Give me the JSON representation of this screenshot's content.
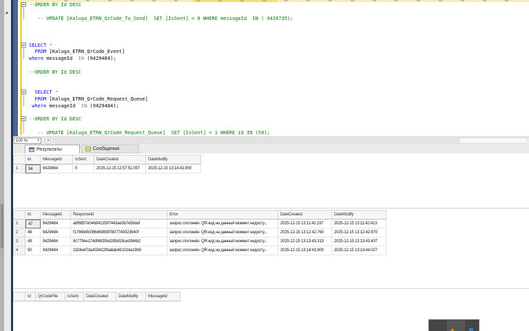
{
  "editor": {
    "zoom_level": "100 %",
    "code_lines": [
      {
        "fold": true,
        "segments": [
          {
            "s": "com",
            "t": "--ORDER BY Id DESC"
          }
        ]
      },
      {
        "segments": []
      },
      {
        "segments": [
          {
            "s": "com",
            "t": "   -- UPDATE [Kaluga_ETRN_QrCode_To_Send]  SET [IsSent] = 0 WHERE messageId  IN ( 9426735);"
          }
        ]
      },
      {
        "segments": []
      },
      {
        "segments": []
      },
      {
        "segments": []
      },
      {
        "fold": true,
        "segments": [
          {
            "s": "kw",
            "t": "SELECT"
          },
          {
            "s": "op",
            "t": " *"
          }
        ]
      },
      {
        "segments": [
          {
            "s": "def",
            "t": "  "
          },
          {
            "s": "kw",
            "t": "FROM"
          },
          {
            "s": "def",
            "t": " [Kaluga_ETRN_QrCode_Event]"
          }
        ]
      },
      {
        "segments": [
          {
            "s": "kw",
            "t": "where"
          },
          {
            "s": "def",
            "t": " messageId  "
          },
          {
            "s": "op",
            "t": "IN"
          },
          {
            "s": "def",
            "t": " (9429484);"
          }
        ]
      },
      {
        "segments": []
      },
      {
        "segments": [
          {
            "s": "com",
            "t": "--ORDER BY Id DESC"
          }
        ]
      },
      {
        "segments": []
      },
      {
        "segments": []
      },
      {
        "fold": true,
        "segments": [
          {
            "s": "def",
            "t": "  "
          },
          {
            "s": "kw",
            "t": "SELECT"
          },
          {
            "s": "op",
            "t": " *"
          }
        ]
      },
      {
        "segments": [
          {
            "s": "def",
            "t": "  "
          },
          {
            "s": "kw",
            "t": "FROM"
          },
          {
            "s": "def",
            "t": " [Kaluga_ETRN_QrCode_Request_Queue]"
          }
        ]
      },
      {
        "segments": [
          {
            "s": "def",
            "t": " "
          },
          {
            "s": "kw",
            "t": "where"
          },
          {
            "s": "def",
            "t": " messageId  "
          },
          {
            "s": "op",
            "t": "IN"
          },
          {
            "s": "def",
            "t": " (9429484);"
          }
        ]
      },
      {
        "segments": []
      },
      {
        "fold": true,
        "segments": [
          {
            "s": "com",
            "t": "--ORDER BY Id DESC"
          }
        ]
      },
      {
        "segments": []
      },
      {
        "segments": [
          {
            "s": "com",
            "t": "   -- UPDATE [Kaluga_ETRN_QrCode_Request_Queue]  SET [IsSent] = 1 WHERE id IN (50);"
          }
        ]
      }
    ]
  },
  "results_pane": {
    "tabs": [
      {
        "label": "Результаты",
        "icon": "results-grid-icon",
        "selected": true
      },
      {
        "label": "Сообщения",
        "icon": "messages-icon",
        "selected": false
      }
    ],
    "grids": [
      {
        "columns": [
          "Id",
          "MessageId",
          "IsSent",
          "DateCreated",
          "DateModify"
        ],
        "rows": [
          [
            "34",
            "9429484",
            "0",
            "2025-12-15 12:57:51.057",
            "2025-12-15 13:14:43.900"
          ]
        ],
        "selected_cell": {
          "row": 0,
          "col": 0
        }
      },
      {
        "columns": [
          "Id",
          "MessageId",
          "ResponseId",
          "Error",
          "DateCreated",
          "DateModify"
        ],
        "rows": [
          [
            "47",
            "9429484",
            "a8f6857e0468413597443ae5b7e59def",
            "запрос отклонён: QR-код на данный момент недосту...",
            "2025-12-15 13:11:42.197",
            "2025-12-15 13:11:42.413"
          ],
          [
            "48",
            "9429484",
            "f176684fc0864698997807740023640f",
            "запрос отклонён: QR-код на данный момент недосту...",
            "2025-12-15 13:12:42.760",
            "2025-12-15 13:12:42.870"
          ],
          [
            "49",
            "9429484",
            "8c779ee174df4820bd285d19ced364b2",
            "запрос отклонён: QR-код на данный момент недосту...",
            "2025-12-15 13:13:43.313",
            "2025-12-15 13:13:43.407"
          ],
          [
            "50",
            "9429484",
            "1928e87da433422fba8ab461024a19b9",
            "запрос отклонён: QR-код на данный момент недосту...",
            "2025-12-15 13:14:43.900",
            "2025-12-15 13:14:44.027"
          ]
        ],
        "selected_cell": {
          "row": 0,
          "col": 0
        }
      },
      {
        "columns": [
          "Id",
          "QrCodeFile",
          "IsSent",
          "DateCreated",
          "DateModify",
          "MessageId"
        ],
        "rows": []
      }
    ]
  },
  "icons": {
    "scroll_up": "▲",
    "scroll_left": "◂",
    "dropdown": "▾"
  },
  "colors": {
    "keyword": "#0000ff",
    "comment": "#007d00",
    "operator": "#808080",
    "navy_rail": "#20365a",
    "blue_rail": "#4a6794",
    "change_bar_yellow": "#e8d74c",
    "top_strip_yellow": "#f2eeb6",
    "top_strip_bright": "#f0e267"
  }
}
